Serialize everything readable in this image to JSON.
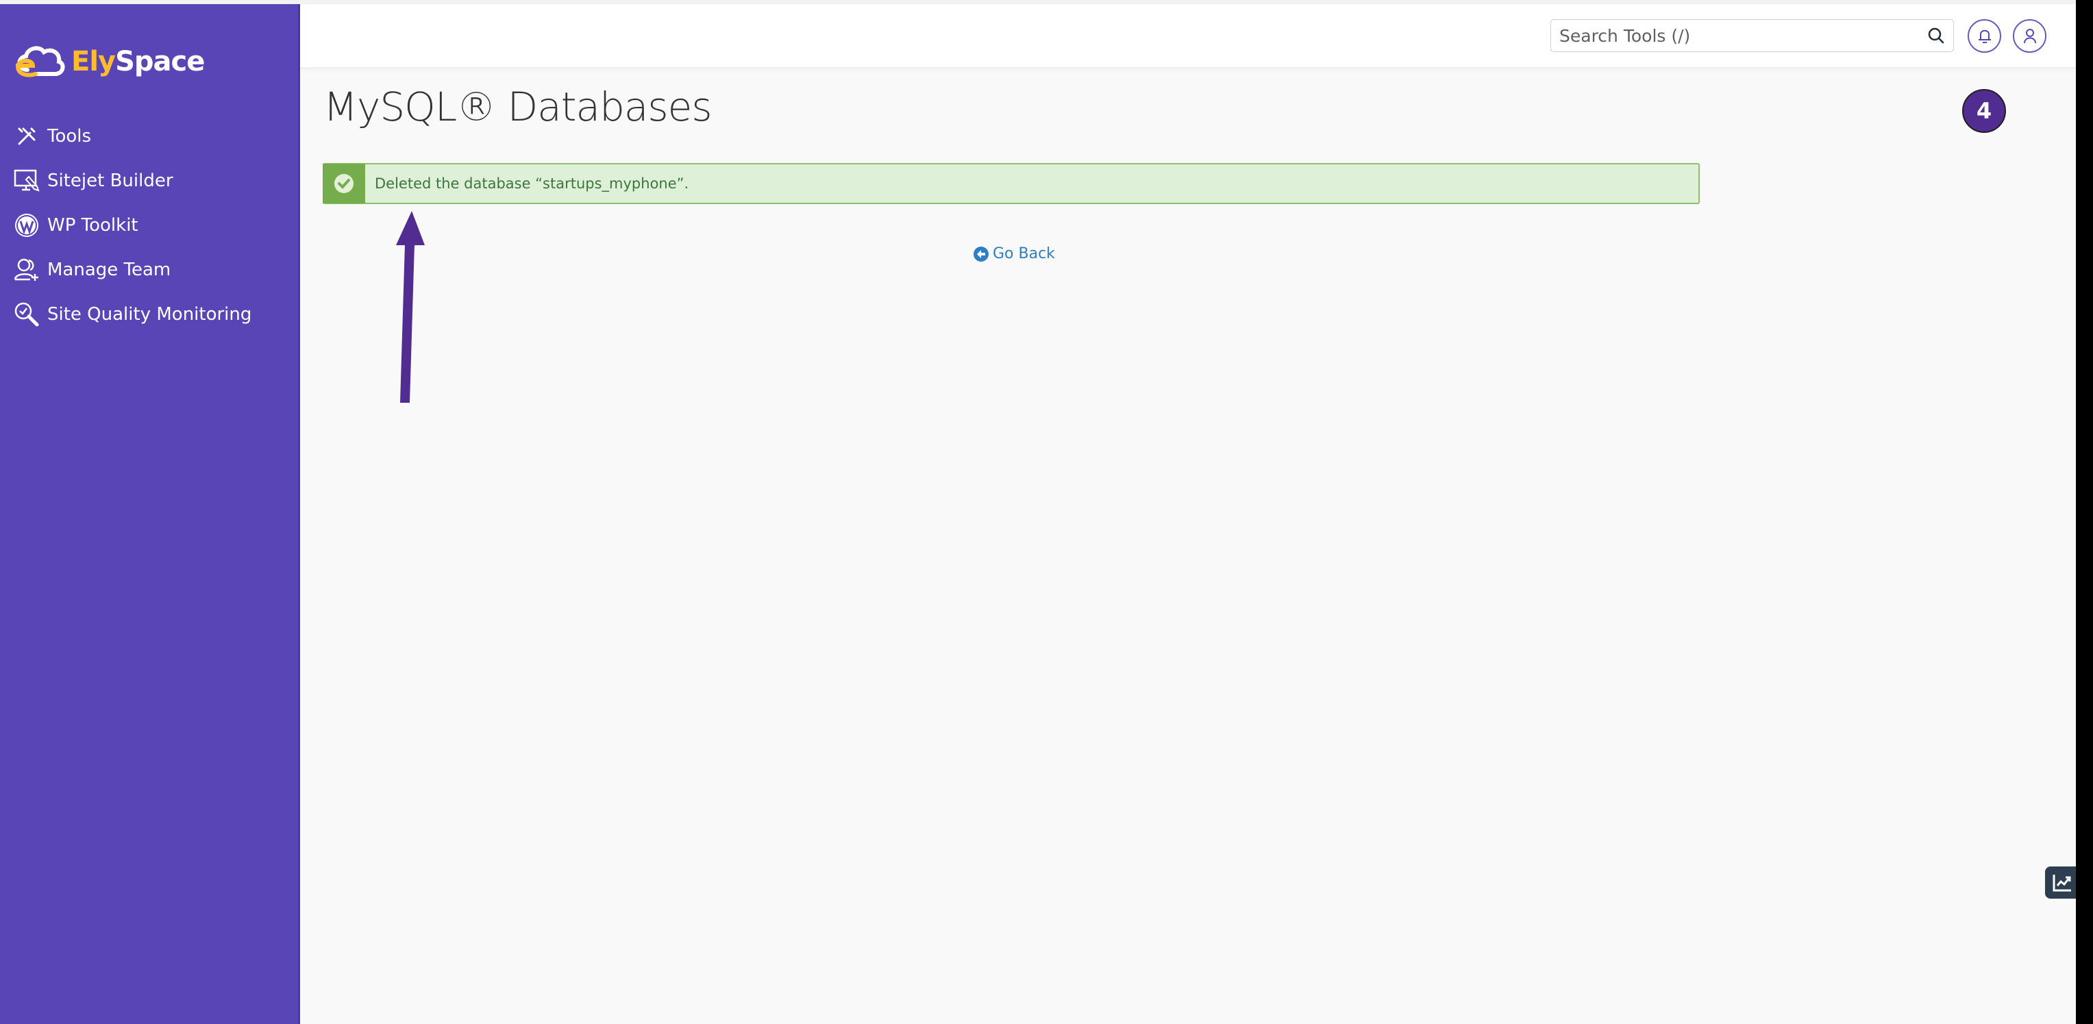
{
  "brand": {
    "name_part1": "Ely",
    "name_part2": "Space",
    "colors": {
      "sidebar": "#5a45b7",
      "accent_yellow": "#fdbb2d",
      "badge": "#522d91"
    }
  },
  "sidebar": {
    "items": [
      {
        "label": "Tools",
        "icon": "tools-icon"
      },
      {
        "label": "Sitejet Builder",
        "icon": "sitejet-icon"
      },
      {
        "label": "WP Toolkit",
        "icon": "wordpress-icon"
      },
      {
        "label": "Manage Team",
        "icon": "manage-team-icon"
      },
      {
        "label": "Site Quality Monitoring",
        "icon": "site-quality-icon"
      }
    ]
  },
  "header": {
    "search_placeholder": "Search Tools (/)",
    "search_value": ""
  },
  "main": {
    "page_title": "MySQL® Databases",
    "step_badge": "4",
    "alert": {
      "type": "success",
      "message": "Deleted the database “startups_myphone”."
    },
    "go_back_label": "Go Back"
  }
}
